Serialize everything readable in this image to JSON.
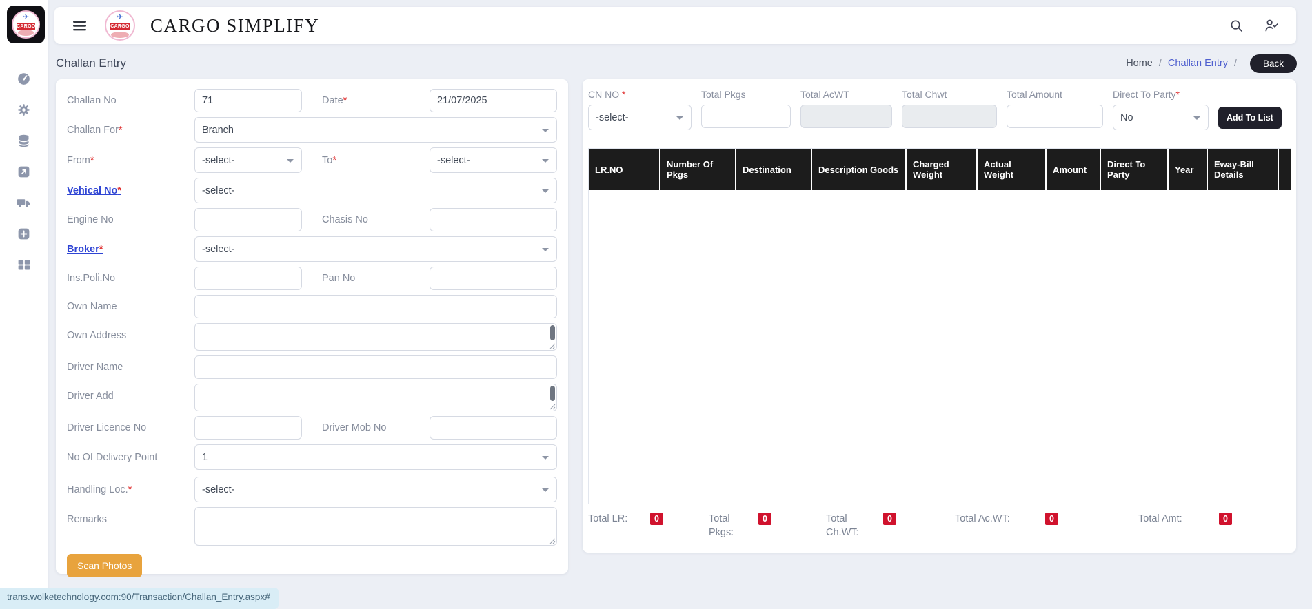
{
  "header": {
    "brand": "CARGO SIMPLIFY",
    "logo_text": "CARGO"
  },
  "sidebar": {
    "icons": [
      "speedometer",
      "gear",
      "database",
      "arrow-up-right-square",
      "truck",
      "plus-square",
      "grid"
    ]
  },
  "page": {
    "title": "Challan Entry",
    "breadcrumb": {
      "home": "Home",
      "separator": "/",
      "current": "Challan Entry",
      "back": "Back"
    }
  },
  "ui": {
    "required": "*"
  },
  "form": {
    "challan_no": {
      "label": "Challan No",
      "value": "71"
    },
    "date": {
      "label": "Date",
      "value": "21/07/2025"
    },
    "challan_for": {
      "label": "Challan For",
      "value": "Branch"
    },
    "from": {
      "label": "From",
      "value": "-select-"
    },
    "to": {
      "label": "To",
      "value": "-select-"
    },
    "vehical_no": {
      "label": "Vehical No",
      "value": "-select-"
    },
    "engine_no": {
      "label": "Engine No",
      "value": ""
    },
    "chasis_no": {
      "label": "Chasis No",
      "value": ""
    },
    "broker": {
      "label": "Broker",
      "value": "-select-"
    },
    "ins_poli_no": {
      "label": "Ins.Poli.No",
      "value": ""
    },
    "pan_no": {
      "label": "Pan No",
      "value": ""
    },
    "own_name": {
      "label": "Own Name",
      "value": ""
    },
    "own_address": {
      "label": "Own Address",
      "value": ""
    },
    "driver_name": {
      "label": "Driver Name",
      "value": ""
    },
    "driver_add": {
      "label": "Driver Add",
      "value": ""
    },
    "driver_licence_no": {
      "label": "Driver Licence No",
      "value": ""
    },
    "driver_mob_no": {
      "label": "Driver Mob No",
      "value": ""
    },
    "no_of_delivery_point": {
      "label": "No Of Delivery Point",
      "value": "1"
    },
    "handling_loc": {
      "label": "Handling Loc.",
      "value": "-select-"
    },
    "remarks": {
      "label": "Remarks",
      "value": ""
    },
    "scan_photos": "Scan Photos"
  },
  "cn_panel": {
    "cn_no": {
      "label": "CN NO ",
      "value": "-select-"
    },
    "total_pkgs": {
      "label": "Total Pkgs",
      "value": ""
    },
    "total_acwt": {
      "label": "Total AcWT",
      "value": ""
    },
    "total_chwt": {
      "label": "Total Chwt",
      "value": ""
    },
    "total_amount": {
      "label": "Total Amount",
      "value": ""
    },
    "direct_to_party": {
      "label": "Direct To Party",
      "value": "No"
    },
    "add_to_list": "Add To List",
    "table": {
      "headers": [
        "LR.NO",
        "Number Of Pkgs",
        "Destination",
        "Description Goods",
        "Charged Weight",
        "Actual Weight",
        "Amount",
        "Direct To Party",
        "Year",
        "Eway-Bill Details"
      ],
      "rows": []
    },
    "totals": [
      {
        "label": "Total LR:",
        "value": "0"
      },
      {
        "label": "Total Pkgs:",
        "value": "0"
      },
      {
        "label": "Total Ch.WT:",
        "value": "0"
      },
      {
        "label": "Total Ac.WT:",
        "value": "0"
      },
      {
        "label": "Total Amt:",
        "value": "0"
      }
    ]
  },
  "statusbar": {
    "url": "trans.wolketechnology.com:90/Transaction/Challan_Entry.aspx#"
  },
  "colors": {
    "accent_dark": "#20202b",
    "table_header_bg": "#1c1c1c",
    "orange_button": "#e8a33d",
    "badge_red": "#d0122d",
    "form_link_blue": "#2f45d4",
    "breadcrumb_link_blue": "#5060cf"
  }
}
